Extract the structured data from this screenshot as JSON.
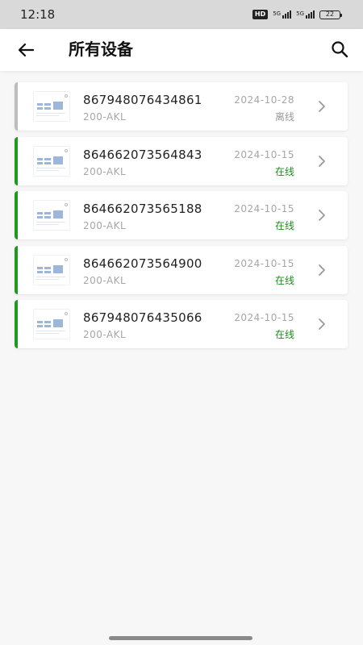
{
  "status_bar": {
    "time": "12:18",
    "hd_badge": "HD",
    "network_1": "5G",
    "network_2": "5G",
    "battery": "22"
  },
  "header": {
    "title": "所有设备",
    "back_icon": "arrow-left-icon",
    "search_icon": "search-icon"
  },
  "colors": {
    "online": "#1e9a1e",
    "offline": "#bdbdbd",
    "online_text": "#1e8a1e",
    "offline_text": "#9a9a9a"
  },
  "devices": [
    {
      "id": "867948076434861",
      "model": "200-AKL",
      "date": "2024-10-28",
      "status": "离线",
      "online": false
    },
    {
      "id": "864662073564843",
      "model": "200-AKL",
      "date": "2024-10-15",
      "status": "在线",
      "online": true
    },
    {
      "id": "864662073565188",
      "model": "200-AKL",
      "date": "2024-10-15",
      "status": "在线",
      "online": true
    },
    {
      "id": "864662073564900",
      "model": "200-AKL",
      "date": "2024-10-15",
      "status": "在线",
      "online": true
    },
    {
      "id": "867948076435066",
      "model": "200-AKL",
      "date": "2024-10-15",
      "status": "在线",
      "online": true
    }
  ]
}
